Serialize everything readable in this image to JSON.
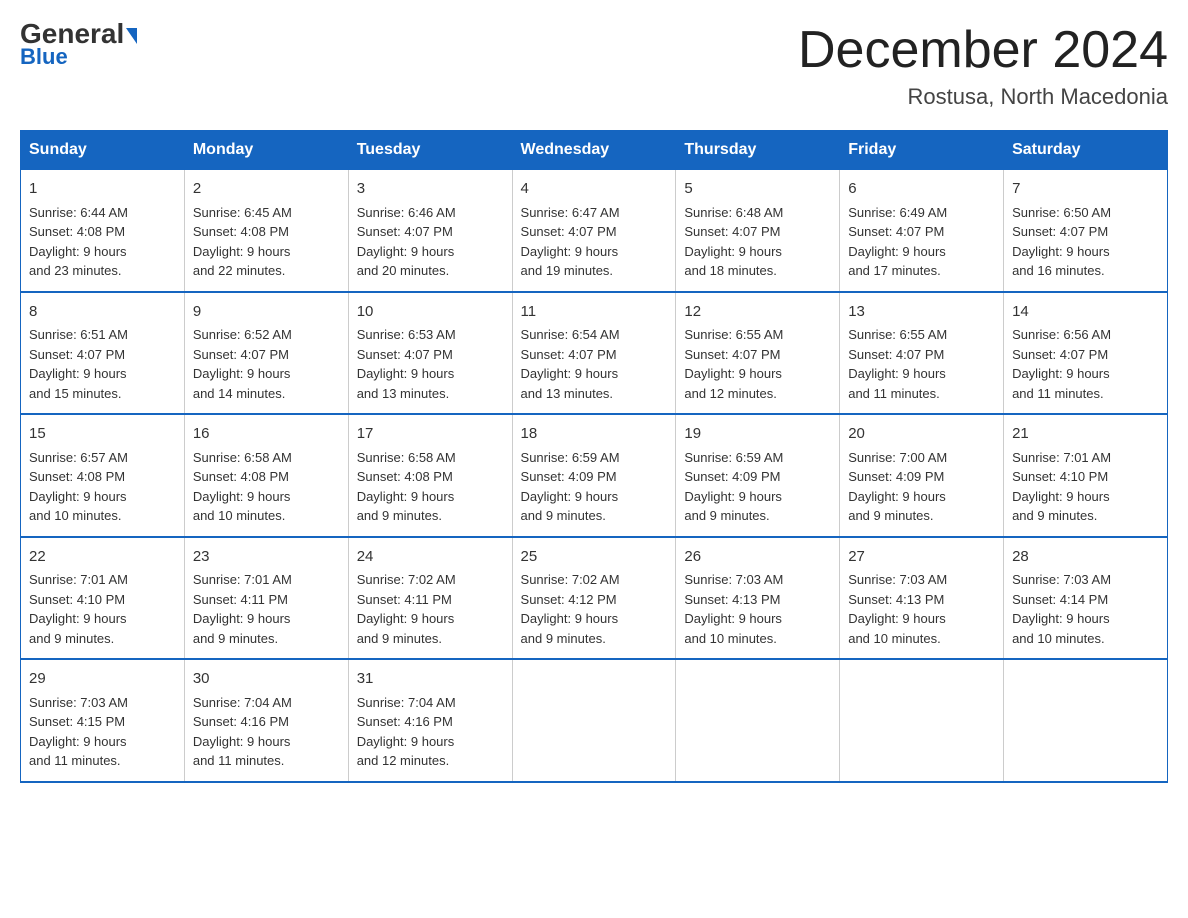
{
  "header": {
    "logo_general": "General",
    "logo_blue": "Blue",
    "title": "December 2024",
    "subtitle": "Rostusa, North Macedonia"
  },
  "days_of_week": [
    "Sunday",
    "Monday",
    "Tuesday",
    "Wednesday",
    "Thursday",
    "Friday",
    "Saturday"
  ],
  "weeks": [
    [
      {
        "day": "1",
        "sunrise": "6:44 AM",
        "sunset": "4:08 PM",
        "daylight": "9 hours and 23 minutes."
      },
      {
        "day": "2",
        "sunrise": "6:45 AM",
        "sunset": "4:08 PM",
        "daylight": "9 hours and 22 minutes."
      },
      {
        "day": "3",
        "sunrise": "6:46 AM",
        "sunset": "4:07 PM",
        "daylight": "9 hours and 20 minutes."
      },
      {
        "day": "4",
        "sunrise": "6:47 AM",
        "sunset": "4:07 PM",
        "daylight": "9 hours and 19 minutes."
      },
      {
        "day": "5",
        "sunrise": "6:48 AM",
        "sunset": "4:07 PM",
        "daylight": "9 hours and 18 minutes."
      },
      {
        "day": "6",
        "sunrise": "6:49 AM",
        "sunset": "4:07 PM",
        "daylight": "9 hours and 17 minutes."
      },
      {
        "day": "7",
        "sunrise": "6:50 AM",
        "sunset": "4:07 PM",
        "daylight": "9 hours and 16 minutes."
      }
    ],
    [
      {
        "day": "8",
        "sunrise": "6:51 AM",
        "sunset": "4:07 PM",
        "daylight": "9 hours and 15 minutes."
      },
      {
        "day": "9",
        "sunrise": "6:52 AM",
        "sunset": "4:07 PM",
        "daylight": "9 hours and 14 minutes."
      },
      {
        "day": "10",
        "sunrise": "6:53 AM",
        "sunset": "4:07 PM",
        "daylight": "9 hours and 13 minutes."
      },
      {
        "day": "11",
        "sunrise": "6:54 AM",
        "sunset": "4:07 PM",
        "daylight": "9 hours and 13 minutes."
      },
      {
        "day": "12",
        "sunrise": "6:55 AM",
        "sunset": "4:07 PM",
        "daylight": "9 hours and 12 minutes."
      },
      {
        "day": "13",
        "sunrise": "6:55 AM",
        "sunset": "4:07 PM",
        "daylight": "9 hours and 11 minutes."
      },
      {
        "day": "14",
        "sunrise": "6:56 AM",
        "sunset": "4:07 PM",
        "daylight": "9 hours and 11 minutes."
      }
    ],
    [
      {
        "day": "15",
        "sunrise": "6:57 AM",
        "sunset": "4:08 PM",
        "daylight": "9 hours and 10 minutes."
      },
      {
        "day": "16",
        "sunrise": "6:58 AM",
        "sunset": "4:08 PM",
        "daylight": "9 hours and 10 minutes."
      },
      {
        "day": "17",
        "sunrise": "6:58 AM",
        "sunset": "4:08 PM",
        "daylight": "9 hours and 9 minutes."
      },
      {
        "day": "18",
        "sunrise": "6:59 AM",
        "sunset": "4:09 PM",
        "daylight": "9 hours and 9 minutes."
      },
      {
        "day": "19",
        "sunrise": "6:59 AM",
        "sunset": "4:09 PM",
        "daylight": "9 hours and 9 minutes."
      },
      {
        "day": "20",
        "sunrise": "7:00 AM",
        "sunset": "4:09 PM",
        "daylight": "9 hours and 9 minutes."
      },
      {
        "day": "21",
        "sunrise": "7:01 AM",
        "sunset": "4:10 PM",
        "daylight": "9 hours and 9 minutes."
      }
    ],
    [
      {
        "day": "22",
        "sunrise": "7:01 AM",
        "sunset": "4:10 PM",
        "daylight": "9 hours and 9 minutes."
      },
      {
        "day": "23",
        "sunrise": "7:01 AM",
        "sunset": "4:11 PM",
        "daylight": "9 hours and 9 minutes."
      },
      {
        "day": "24",
        "sunrise": "7:02 AM",
        "sunset": "4:11 PM",
        "daylight": "9 hours and 9 minutes."
      },
      {
        "day": "25",
        "sunrise": "7:02 AM",
        "sunset": "4:12 PM",
        "daylight": "9 hours and 9 minutes."
      },
      {
        "day": "26",
        "sunrise": "7:03 AM",
        "sunset": "4:13 PM",
        "daylight": "9 hours and 10 minutes."
      },
      {
        "day": "27",
        "sunrise": "7:03 AM",
        "sunset": "4:13 PM",
        "daylight": "9 hours and 10 minutes."
      },
      {
        "day": "28",
        "sunrise": "7:03 AM",
        "sunset": "4:14 PM",
        "daylight": "9 hours and 10 minutes."
      }
    ],
    [
      {
        "day": "29",
        "sunrise": "7:03 AM",
        "sunset": "4:15 PM",
        "daylight": "9 hours and 11 minutes."
      },
      {
        "day": "30",
        "sunrise": "7:04 AM",
        "sunset": "4:16 PM",
        "daylight": "9 hours and 11 minutes."
      },
      {
        "day": "31",
        "sunrise": "7:04 AM",
        "sunset": "4:16 PM",
        "daylight": "9 hours and 12 minutes."
      },
      null,
      null,
      null,
      null
    ]
  ],
  "labels": {
    "sunrise": "Sunrise:",
    "sunset": "Sunset:",
    "daylight": "Daylight:"
  }
}
